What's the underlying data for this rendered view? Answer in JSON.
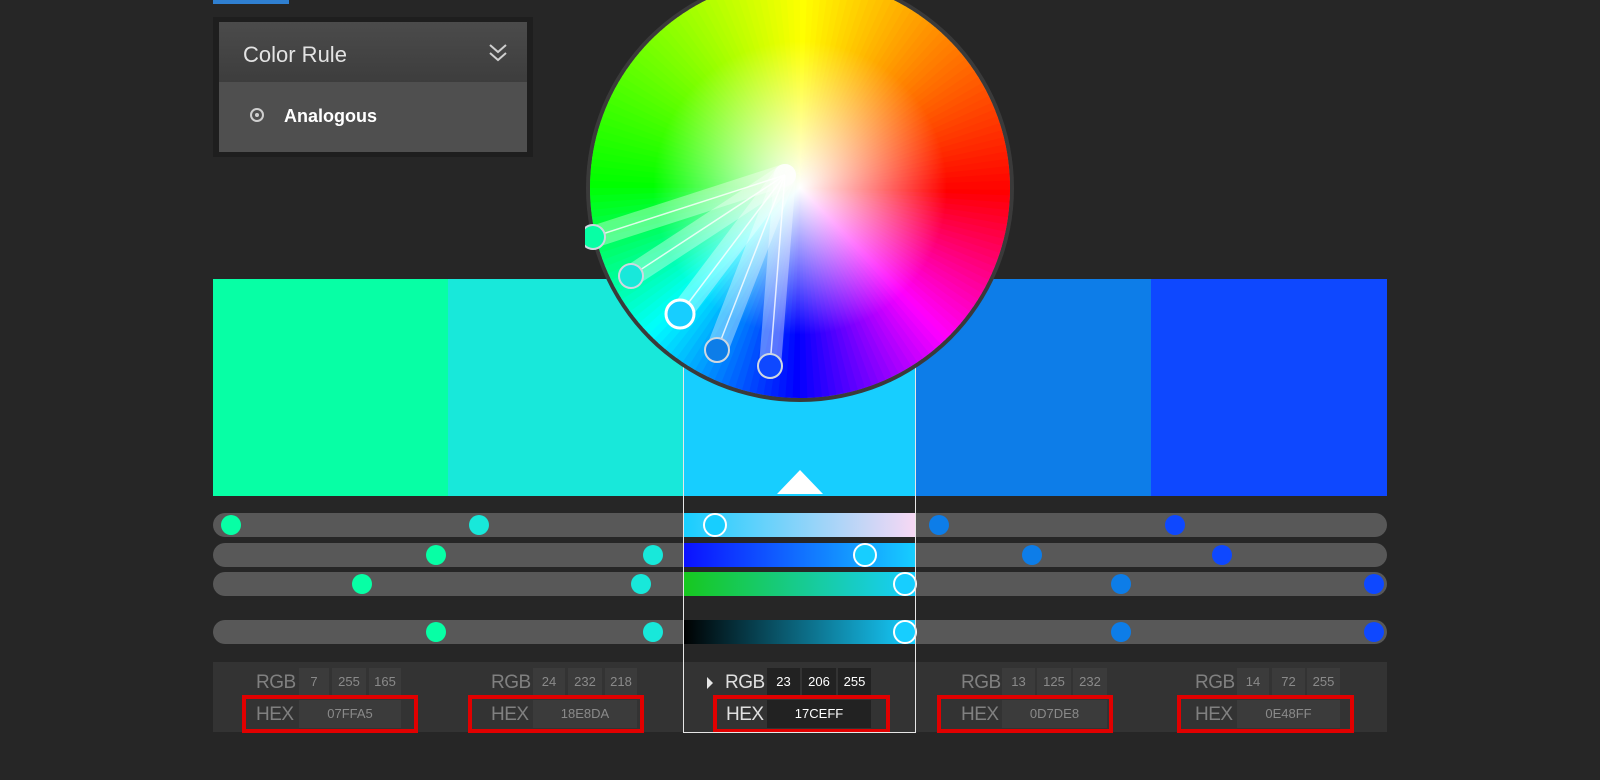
{
  "color_rule": {
    "title": "Color Rule",
    "selected": "Analogous"
  },
  "labels": {
    "rgb": "RGB",
    "hex": "HEX"
  },
  "active_index": 2,
  "swatches": [
    {
      "hex": "07FFA5",
      "r": "7",
      "g": "255",
      "b": "165",
      "color": "#07FFA5"
    },
    {
      "hex": "18E8DA",
      "r": "24",
      "g": "232",
      "b": "218",
      "color": "#18E8DA"
    },
    {
      "hex": "17CEFF",
      "r": "23",
      "g": "206",
      "b": "255",
      "color": "#17CEFF"
    },
    {
      "hex": "0D7DE8",
      "r": "13",
      "g": "125",
      "b": "232",
      "color": "#0D7DE8"
    },
    {
      "hex": "0E48FF",
      "r": "14",
      "g": "72",
      "b": "255",
      "color": "#0E48FF"
    }
  ],
  "colors": {
    "background": "#262626",
    "highlight_border": "#E10000",
    "tab_accent": "#2F7FD0"
  }
}
